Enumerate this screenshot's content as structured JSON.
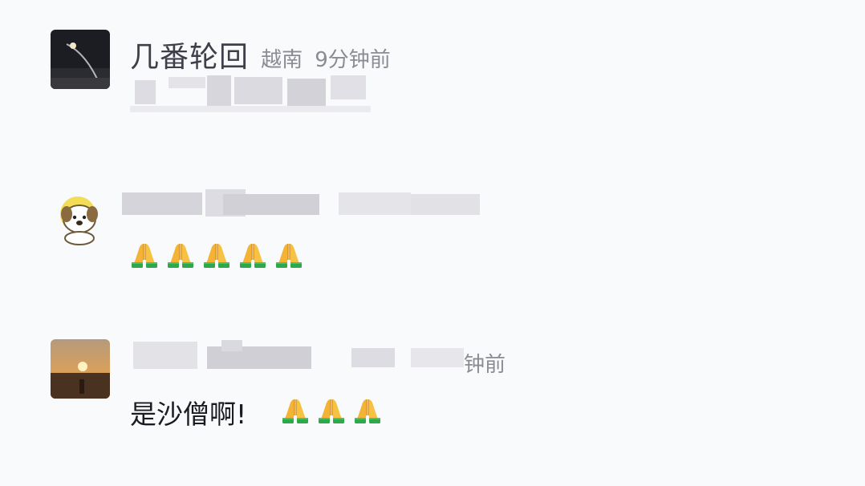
{
  "comments": [
    {
      "username": "几番轮回",
      "location": "越南",
      "time": "9分钟前"
    },
    {
      "emoji_icon": "folded-hands-emoji",
      "emoji_count": 5
    },
    {
      "time": "钟前",
      "text": "是沙僧啊!",
      "emoji_icon": "folded-hands-emoji",
      "emoji_count": 3
    }
  ]
}
